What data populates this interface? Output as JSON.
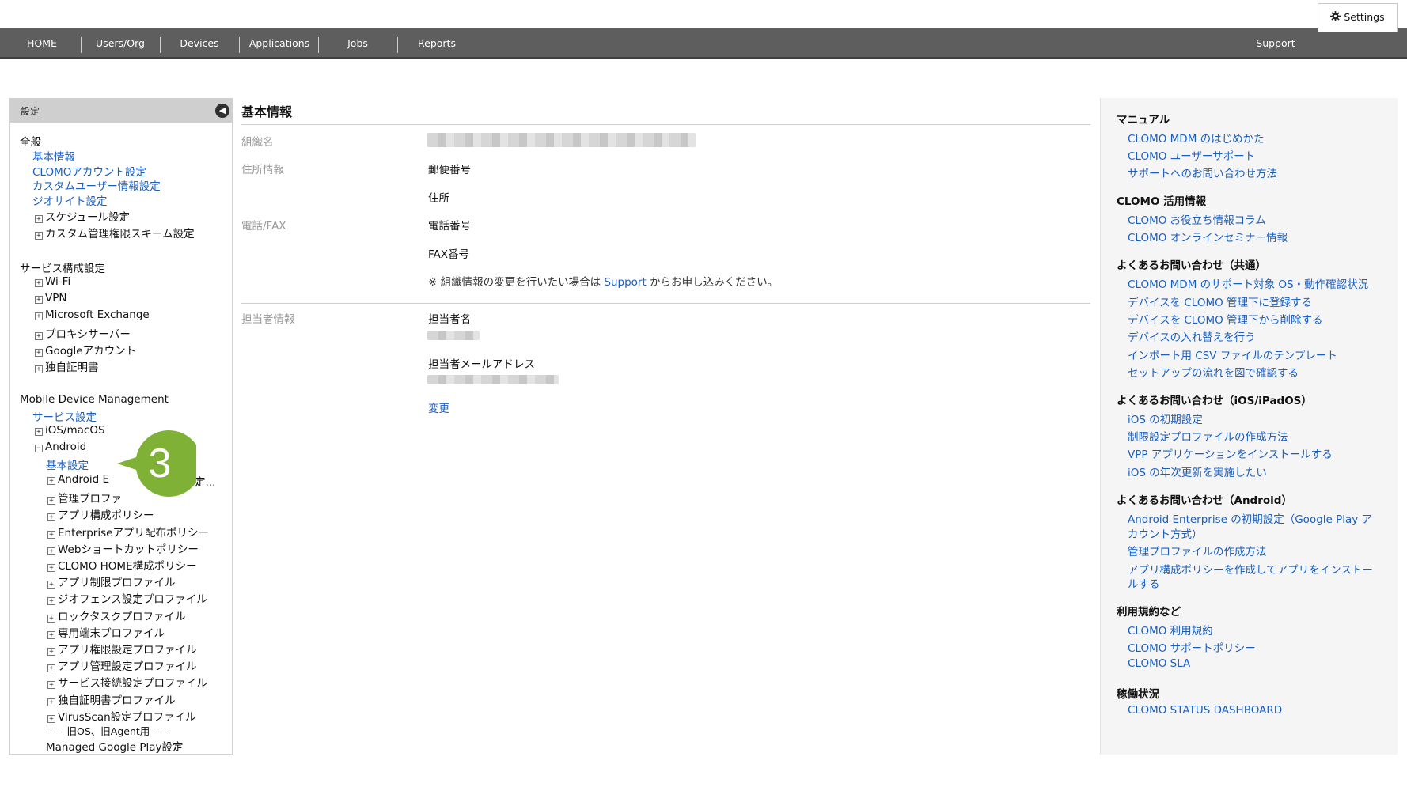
{
  "nav": {
    "items": [
      "HOME",
      "Users/Org",
      "Devices",
      "Applications",
      "Jobs",
      "Reports"
    ],
    "support": "Support",
    "settings": "Settings"
  },
  "sidebar": {
    "title": "設定",
    "groups": {
      "general": {
        "title": "全般",
        "items": [
          "基本情報",
          "CLOMOアカウント設定",
          "カスタムユーザー情報設定",
          "ジオサイト設定",
          "スケジュール設定",
          "カスタム管理権限スキーム設定"
        ]
      },
      "service": {
        "title": "サービス構成設定",
        "items": [
          "Wi-Fi",
          "VPN",
          "Microsoft Exchange",
          "プロキシサーバー",
          "Googleアカウント",
          "独自証明書"
        ]
      },
      "mdm": {
        "title": "Mobile Device Management",
        "service_settings": "サービス設定",
        "ios": "iOS/macOS",
        "android": "Android",
        "android_basic": "基本設定",
        "android_items": [
          "Android E",
          "管理プロファ",
          "アプリ構成ポリシー",
          "Enterpriseアプリ配布ポリシー",
          "Webショートカットポリシー",
          "CLOMO HOME構成ポリシー",
          "アプリ制限プロファイル",
          "ジオフェンス設定プロファイル",
          "ロックタスクプロファイル",
          "専用端末プロファイル",
          "アプリ権限設定プロファイル",
          "アプリ管理設定プロファイル",
          "サービス接続設定プロファイル",
          "独自証明書プロファイル",
          "VirusScan設定プロファイル"
        ],
        "android_e_tail": "定...",
        "legacy_divider": "----- 旧OS、旧Agent用 -----",
        "managed_play": "Managed Google Play設定"
      }
    }
  },
  "callout": {
    "number": "3",
    "color": "#7fb136"
  },
  "main": {
    "title": "基本情報",
    "org_label": "組織名",
    "address_label": "住所情報",
    "postal_label": "郵便番号",
    "address": "住所",
    "phone_label": "電話/FAX",
    "phone": "電話番号",
    "fax": "FAX番号",
    "note_before": "※ 組織情報の変更を行いたい場合は",
    "note_link": "Support",
    "note_after": "からお申し込みください。",
    "contact_label": "担当者情報",
    "contact_name": "担当者名",
    "contact_email": "担当者メールアドレス",
    "change": "変更"
  },
  "right": {
    "manual": {
      "title": "マニュアル",
      "links": [
        "CLOMO MDM のはじめかた",
        "CLOMO ユーザーサポート",
        "サポートへのお問い合わせ方法"
      ]
    },
    "usage": {
      "title": "CLOMO 活用情報",
      "links": [
        "CLOMO お役立ち情報コラム",
        "CLOMO オンラインセミナー情報"
      ]
    },
    "faq_common": {
      "title": "よくあるお問い合わせ（共通）",
      "links": [
        "CLOMO MDM のサポート対象 OS・動作確認状況",
        "デバイスを CLOMO 管理下に登録する",
        "デバイスを CLOMO 管理下から削除する",
        "デバイスの入れ替えを行う",
        "インポート用 CSV ファイルのテンプレート",
        "セットアップの流れを図で確認する"
      ]
    },
    "faq_ios": {
      "title": "よくあるお問い合わせ（iOS/iPadOS）",
      "links": [
        "iOS の初期設定",
        "制限設定プロファイルの作成方法",
        "VPP アプリケーションをインストールする",
        "iOS の年次更新を実施したい"
      ]
    },
    "faq_android": {
      "title": "よくあるお問い合わせ（Android）",
      "links": [
        "Android Enterprise の初期設定（Google Play ア",
        "カウント方式）",
        "管理プロファイルの作成方法",
        "アプリ構成ポリシーを作成してアプリをインストー",
        "ルする"
      ]
    },
    "terms": {
      "title": "利用規約など",
      "links": [
        "CLOMO 利用規約",
        "CLOMO サポートポリシー",
        "CLOMO SLA"
      ]
    },
    "status": {
      "title": "稼働状況",
      "links": [
        "CLOMO STATUS DASHBOARD"
      ]
    }
  }
}
